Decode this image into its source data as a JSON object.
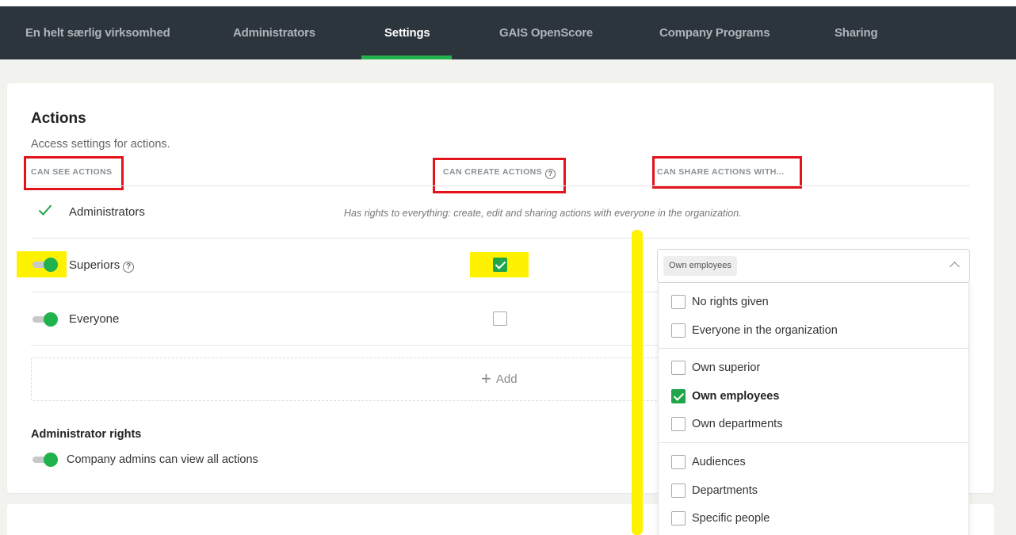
{
  "nav": {
    "tabs": [
      {
        "label": "En helt særlig virksomhed",
        "active": false
      },
      {
        "label": "Administrators",
        "active": false
      },
      {
        "label": "Settings",
        "active": true
      },
      {
        "label": "GAIS OpenScore",
        "active": false
      },
      {
        "label": "Company Programs",
        "active": false
      },
      {
        "label": "Sharing",
        "active": false
      }
    ]
  },
  "actions": {
    "title": "Actions",
    "subtitle": "Access settings for actions.",
    "columns": {
      "can_see": "CAN SEE ACTIONS",
      "can_create": "CAN CREATE ACTIONS",
      "can_share": "CAN SHARE ACTIONS WITH..."
    },
    "rows": {
      "administrators": {
        "label": "Administrators",
        "note": "Has rights to everything: create, edit and sharing actions with everyone in the organization."
      },
      "superiors": {
        "label": "Superiors",
        "can_see": true,
        "can_create": true
      },
      "everyone": {
        "label": "Everyone",
        "can_see": true,
        "can_create": false
      }
    },
    "add_label": "Add"
  },
  "admin_rights": {
    "title": "Administrator rights",
    "label": "Company admins can view all actions",
    "enabled": true
  },
  "share_select": {
    "selected_chip": "Own employees",
    "options": [
      {
        "label": "No rights given",
        "checked": false
      },
      {
        "label": "Everyone in the organization",
        "checked": false
      },
      {
        "label": "Own superior",
        "checked": false
      },
      {
        "label": "Own employees",
        "checked": true
      },
      {
        "label": "Own departments",
        "checked": false
      },
      {
        "label": "Audiences",
        "checked": false
      },
      {
        "label": "Departments",
        "checked": false
      },
      {
        "label": "Specific people",
        "checked": false
      }
    ]
  },
  "icons": {
    "check": "check-icon",
    "help": "question-circle-icon",
    "chevron": "chevron-up-icon",
    "plus": "plus-icon"
  },
  "colors": {
    "nav_bg": "#2c343c",
    "accent_green": "#20b24c",
    "annotation_red": "#e3131b",
    "annotation_yellow": "#fff200"
  }
}
